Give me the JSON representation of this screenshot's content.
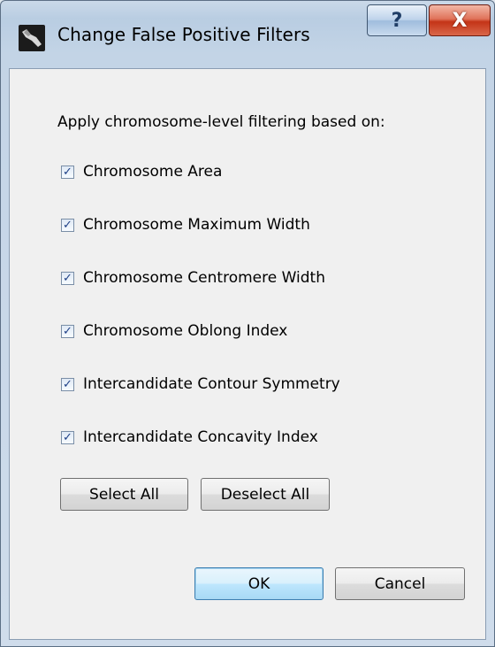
{
  "window": {
    "title": "Change False Positive Filters",
    "help_symbol": "?",
    "close_symbol": "X"
  },
  "prompt": "Apply chromosome-level filtering based on:",
  "filters": [
    {
      "label": "Chromosome Area",
      "checked": true
    },
    {
      "label": "Chromosome Maximum Width",
      "checked": true
    },
    {
      "label": "Chromosome Centromere Width",
      "checked": true
    },
    {
      "label": "Chromosome Oblong Index",
      "checked": true
    },
    {
      "label": "Intercandidate Contour Symmetry",
      "checked": true
    },
    {
      "label": "Intercandidate Concavity Index",
      "checked": true
    }
  ],
  "check_mark": "✓",
  "buttons": {
    "select_all": "Select All",
    "deselect_all": "Deselect All",
    "ok": "OK",
    "cancel": "Cancel"
  },
  "colors": {
    "title_bar": "#b9cde2",
    "close_button": "#c43417",
    "default_button_border": "#3c7fb1",
    "client_background": "#f0f0f0"
  }
}
